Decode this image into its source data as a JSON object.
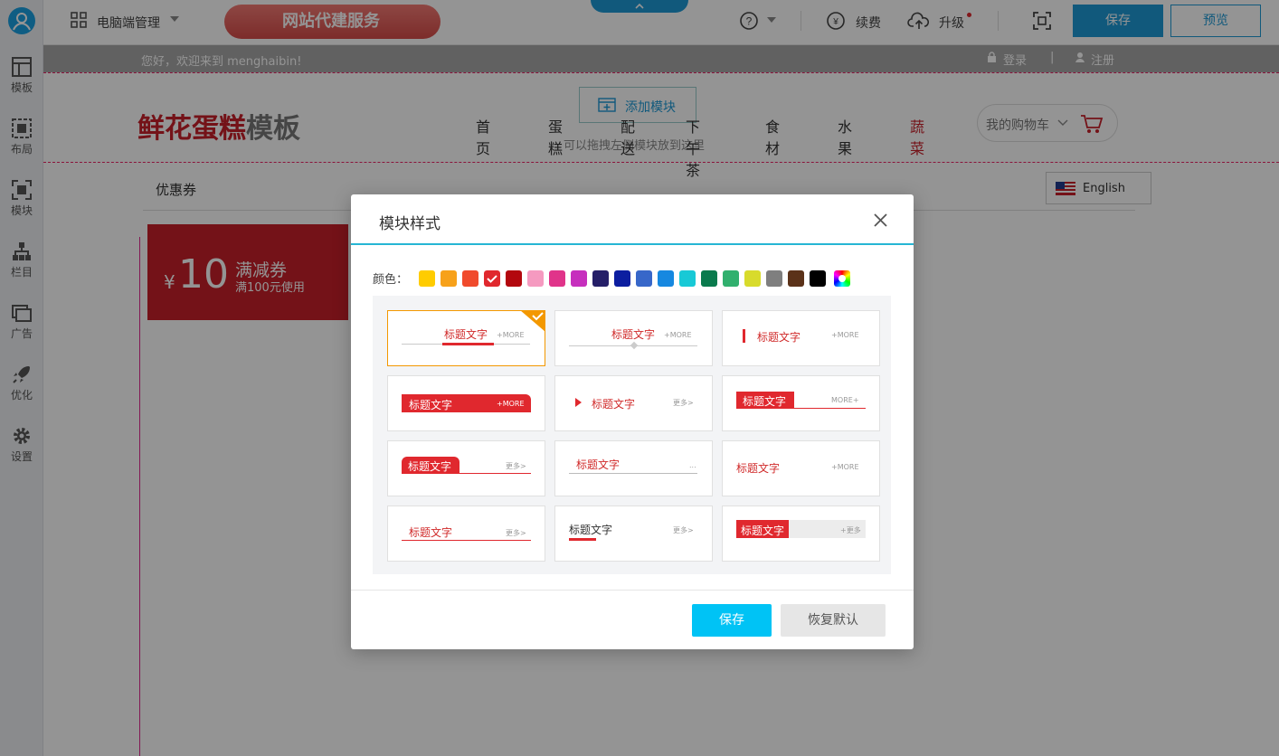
{
  "sidebar": {
    "items": [
      {
        "label": "模板",
        "icon": "template-icon"
      },
      {
        "label": "布局",
        "icon": "layout-icon"
      },
      {
        "label": "模块",
        "icon": "module-icon"
      },
      {
        "label": "栏目",
        "icon": "column-icon"
      },
      {
        "label": "广告",
        "icon": "ad-icon"
      },
      {
        "label": "优化",
        "icon": "rocket-icon"
      },
      {
        "label": "设置",
        "icon": "gear-icon"
      }
    ]
  },
  "topbar": {
    "mode": "电脑端管理",
    "banner": "网站代建服务",
    "renew": "续费",
    "upgrade": "升级",
    "save": "保存",
    "preview": "预览"
  },
  "site": {
    "greeting": "您好，欢迎来到  menghaibin!",
    "login": "登录",
    "sep": "|",
    "register": "注册",
    "logo_main": "鲜花蛋糕",
    "logo_sub": "模板",
    "add_module": "添加模块",
    "drag_hint": "可以拖拽左侧模块放到这里",
    "nav": [
      "首页",
      "蛋糕",
      "配送",
      "下午茶",
      "食材",
      "水果",
      "蔬菜"
    ],
    "cart": "我的购物车",
    "section_title": "优惠券",
    "lang": "English",
    "coupon": {
      "currency": "¥",
      "amount": "10",
      "title": "满减券",
      "rule": "满100元使用"
    }
  },
  "modal": {
    "title": "模块样式",
    "color_label": "颜色：",
    "colors": [
      "#ffcc00",
      "#f7a11a",
      "#f04a2c",
      "#e0282e",
      "#b3080e",
      "#f59ac0",
      "#e0348a",
      "#c62fbd",
      "#251f68",
      "#0c1ea0",
      "#3767c9",
      "#1688e0",
      "#18c9d6",
      "#0a7a4d",
      "#31b06e",
      "#d8db2c",
      "#7f7f7f",
      "#5b3219",
      "#000000"
    ],
    "selected_color": "#e0282e",
    "sample_title": "标题文字",
    "more_en": "+MORE",
    "more_en2": "MORE+",
    "more_cn": "更多>",
    "more_cn2": "+更多",
    "dots": "...",
    "save": "保存",
    "reset": "恢复默认"
  }
}
